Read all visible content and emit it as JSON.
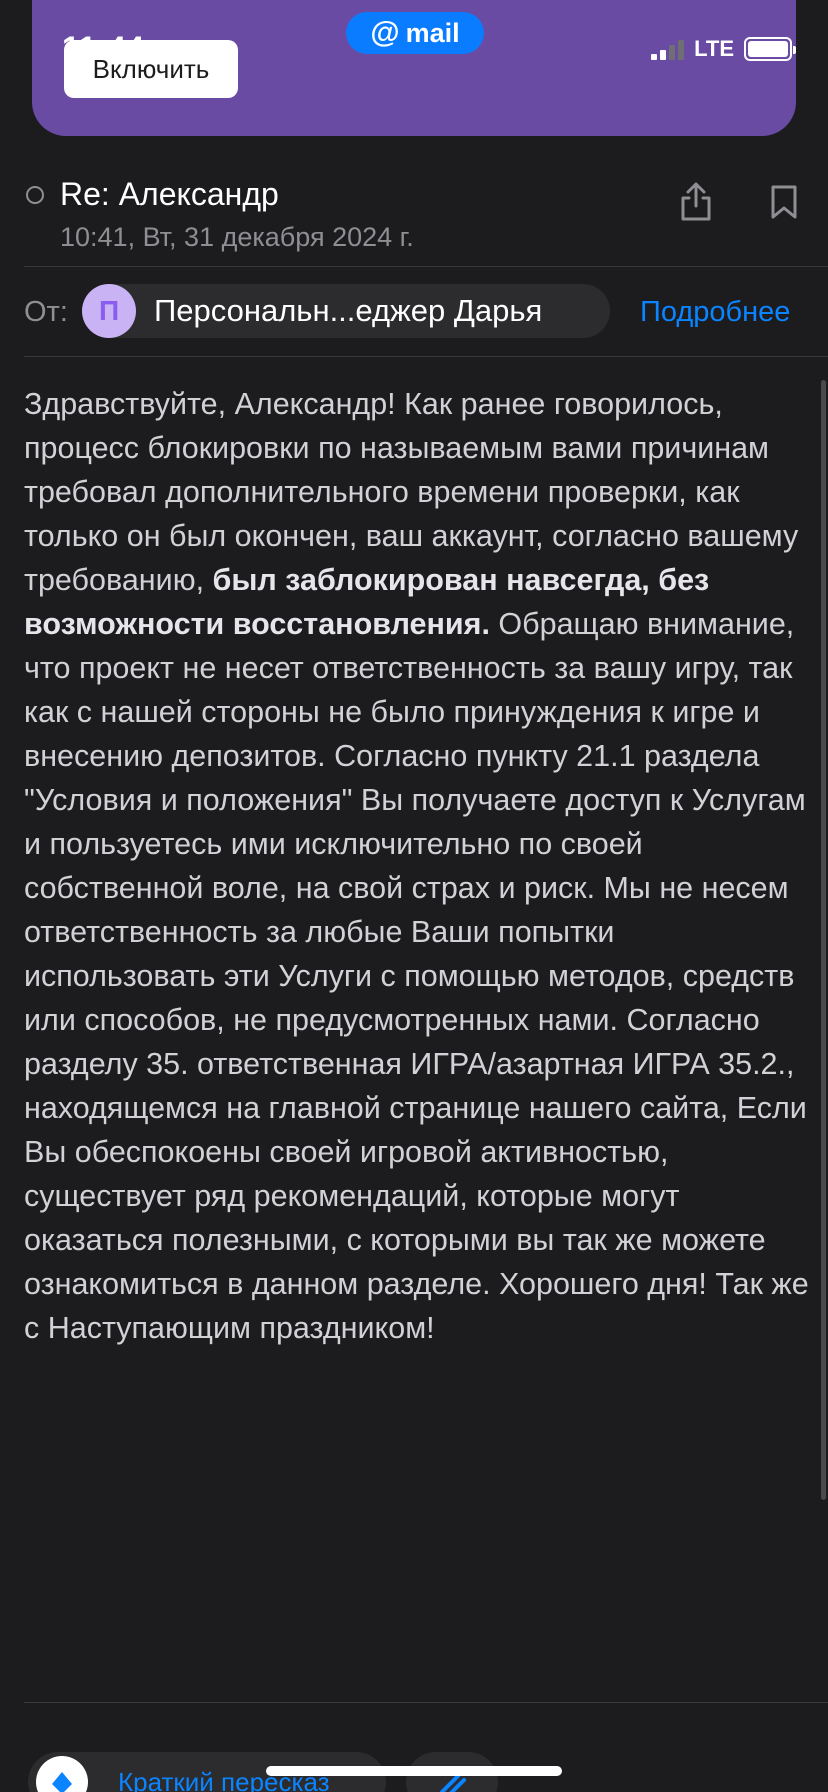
{
  "status_bar": {
    "time": "11:44",
    "app_badge": "mail",
    "network": "LTE"
  },
  "banner": {
    "button_label": "Включить"
  },
  "header": {
    "subject": "Re: Александр",
    "date": "10:41, Вт, 31 декабря 2024 г."
  },
  "from": {
    "label": "От:",
    "avatar_letter": "П",
    "sender": "Персональн...еджер Дарья",
    "details_link": "Подробнее"
  },
  "body": {
    "part1": "Здравствуйте, Александр! Как ранее говорилось, процесс блокировки по называемым вами причинам требовал дополнительного времени проверки, как только он был окончен, ваш аккаунт, согласно вашему требованию, ",
    "bold": "был заблокирован навсегда, без возможности восстановления.",
    "part2": " Обращаю внимание, что проект не несет ответственность за вашу игру, так как с нашей стороны не было принуждения к игре и внесению депозитов. Согласно пункту 21.1 раздела \"Условия и положения\" Вы получаете доступ к Услугам и пользуетесь ими исключительно по своей собственной воле, на свой страх и риск. Мы не несем ответственность за любые Ваши попытки использовать эти Услуги с помощью методов, средств или способов, не предусмотренных нами. Согласно разделу 35. ответственная ИГРА/азартная ИГРА 35.2., находящемся на главной странице нашего сайта,  Если Вы обеспокоены своей игровой активностью, существует ряд рекомендаций, которые могут оказаться полезными, с которыми вы так же можете ознакомиться в данном разделе. Хорошего дня! Так же с Наступающим праздником!"
  },
  "bottom": {
    "summary_label": "Краткий пересказ"
  },
  "colors": {
    "background": "#1c1c1e",
    "accent": "#0a84ff",
    "banner": "#6a4ba3",
    "avatar_bg": "#c9b3f5"
  }
}
